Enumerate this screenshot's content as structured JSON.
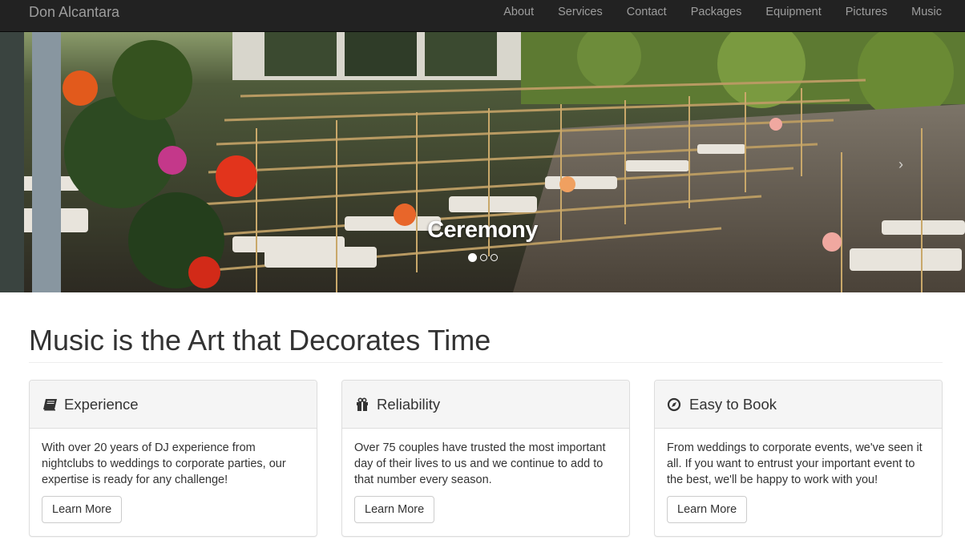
{
  "navbar": {
    "brand": "Don Alcantara",
    "links": [
      "About",
      "Services",
      "Contact",
      "Packages",
      "Equipment",
      "Pictures",
      "Music"
    ]
  },
  "carousel": {
    "caption": "Ceremony",
    "slide_count": 3,
    "active_index": 0,
    "next_arrow": "›"
  },
  "main": {
    "heading": "Music is the Art that Decorates Time"
  },
  "features": [
    {
      "icon": "book-icon",
      "title": "Experience",
      "body": "With over 20 years of DJ experience from nightclubs to weddings to corporate parties, our expertise is ready for any challenge!",
      "button": "Learn More"
    },
    {
      "icon": "gift-icon",
      "title": "Reliability",
      "body": "Over 75 couples have trusted the most important day of their lives to us and we continue to add to that number every season.",
      "button": "Learn More"
    },
    {
      "icon": "compass-icon",
      "title": "Easy to Book",
      "body": "From weddings to corporate events, we've seen it all. If you want to entrust your important event to the best, we'll be happy to work with you!",
      "button": "Learn More"
    }
  ],
  "colors": {
    "navbar_bg": "#222222",
    "nav_text": "#9d9d9d",
    "panel_heading_bg": "#f5f5f5",
    "border": "#dddddd"
  }
}
